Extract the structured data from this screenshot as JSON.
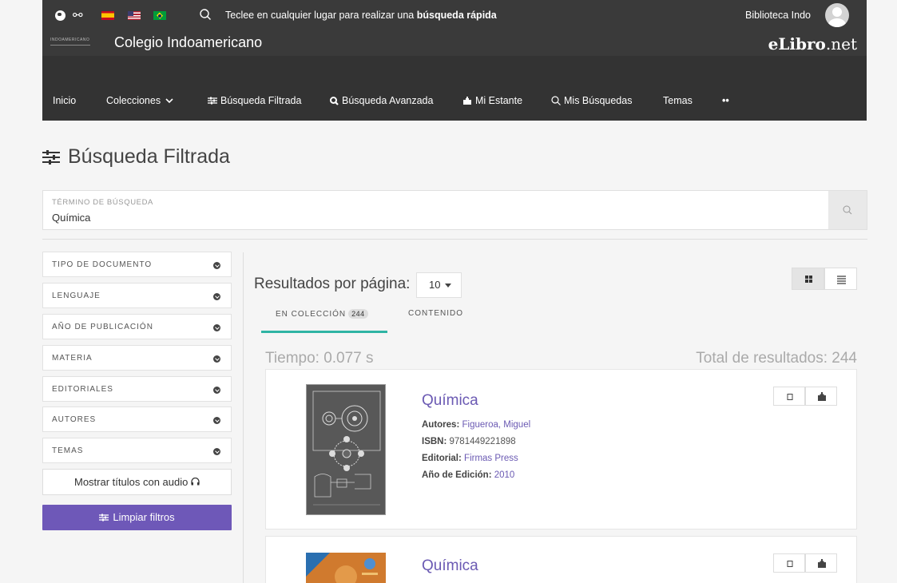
{
  "topbar": {
    "quick_search_prefix": "Teclee en cualquier lugar para realizar una ",
    "quick_search_bold": "búsqueda rápida",
    "library_name": "Biblioteca Indo",
    "logo_text": "INDOAMERICANO",
    "school_name": "Colegio Indoamericano",
    "brand_bold": "eLibro",
    "brand_suffix": ".net"
  },
  "nav": {
    "items": [
      {
        "label": "Inicio"
      },
      {
        "label": "Colecciones"
      },
      {
        "label": "Búsqueda Filtrada"
      },
      {
        "label": "Búsqueda Avanzada"
      },
      {
        "label": "Mi Estante"
      },
      {
        "label": "Mis Búsquedas"
      },
      {
        "label": "Temas"
      },
      {
        "label": "••"
      }
    ]
  },
  "page": {
    "title": "Búsqueda Filtrada"
  },
  "search": {
    "label": "TÉRMINO DE BÚSQUEDA",
    "value": "Química"
  },
  "filters": [
    {
      "label": "TIPO DE DOCUMENTO"
    },
    {
      "label": "LENGUAJE"
    },
    {
      "label": "AÑO DE PUBLICACIÓN"
    },
    {
      "label": "MATERIA"
    },
    {
      "label": "EDITORIALES"
    },
    {
      "label": "AUTORES"
    },
    {
      "label": "TEMAS"
    }
  ],
  "audio_button": "Mostrar títulos con audio",
  "clear_button": "Limpiar filtros",
  "results": {
    "per_page_label": "Resultados por página:",
    "per_page_value": "10",
    "tabs": [
      {
        "label": "EN COLECCIÓN",
        "count": "244"
      },
      {
        "label": "CONTENIDO"
      }
    ],
    "time": "Tiempo: 0.077 s",
    "total": "Total de resultados: 244",
    "items": [
      {
        "title": "Química",
        "authors_label": "Autores:",
        "authors": "Figueroa, Miguel",
        "isbn_label": "ISBN:",
        "isbn": "9781449221898",
        "publisher_label": "Editorial:",
        "publisher": "Firmas Press",
        "year_label": "Año de Edición:",
        "year": "2010"
      },
      {
        "title": "Química"
      }
    ]
  },
  "colors": {
    "accent": "#6e58b8",
    "tab_underline": "#2fb4a4",
    "navbar": "#333333",
    "link": "#6b5ab3"
  }
}
